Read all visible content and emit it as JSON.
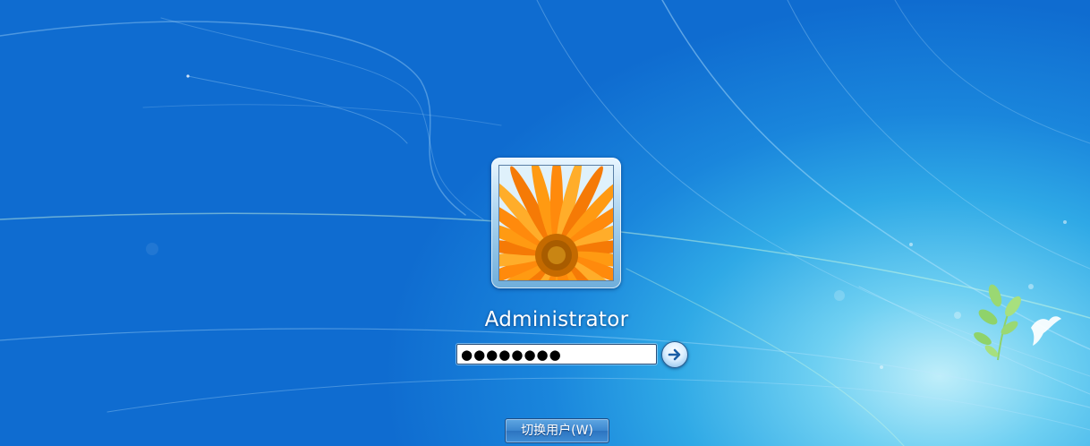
{
  "login": {
    "username": "Administrator",
    "password_value": "●●●●●●●●",
    "switch_user_label": "切换用户(W)"
  },
  "icons": {
    "submit": "arrow-right-icon",
    "avatar": "flower-avatar-image",
    "logo": "windows-bird-plant-icon"
  },
  "colors": {
    "background": "#1a86dc",
    "glow": "#bfeefa",
    "button": "#3b86cf"
  }
}
